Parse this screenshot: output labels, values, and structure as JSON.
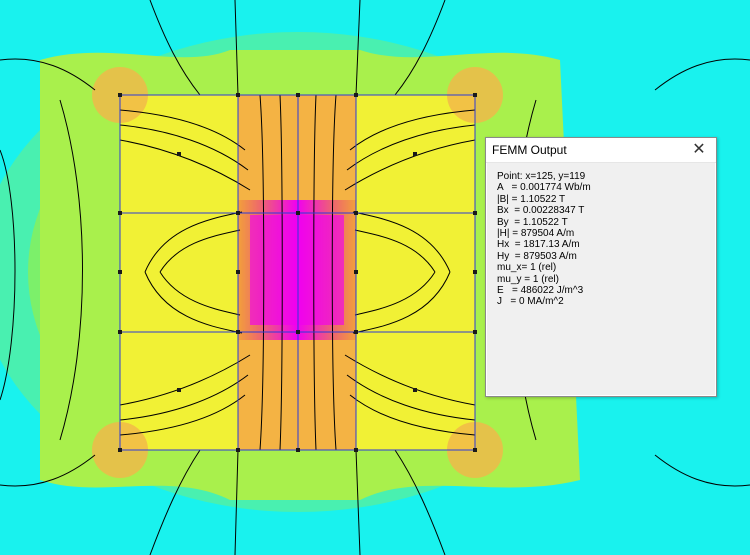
{
  "window": {
    "title": "FEMM Output",
    "close_icon": "close-icon"
  },
  "output": {
    "lines": [
      "Point: x=125, y=119",
      "A   = 0.001774 Wb/m",
      "|B| = 1.10522 T",
      "Bx  = 0.00228347 T",
      "By  = 1.10522 T",
      "|H| = 879504 A/m",
      "Hx  = 1817.13 A/m",
      "Hy  = 879503 A/m",
      "mu_x= 1 (rel)",
      "mu_y = 1 (rel)",
      "E   = 486022 J/m^3",
      "J   = 0 MA/m^2"
    ]
  },
  "colors": {
    "background": "#19f2ee",
    "mid_field": "#6cf07a",
    "high_field": "#f7f334",
    "peak_field": "#f08b50",
    "core": "#f000f0",
    "mesh": "#2d3ad8"
  }
}
